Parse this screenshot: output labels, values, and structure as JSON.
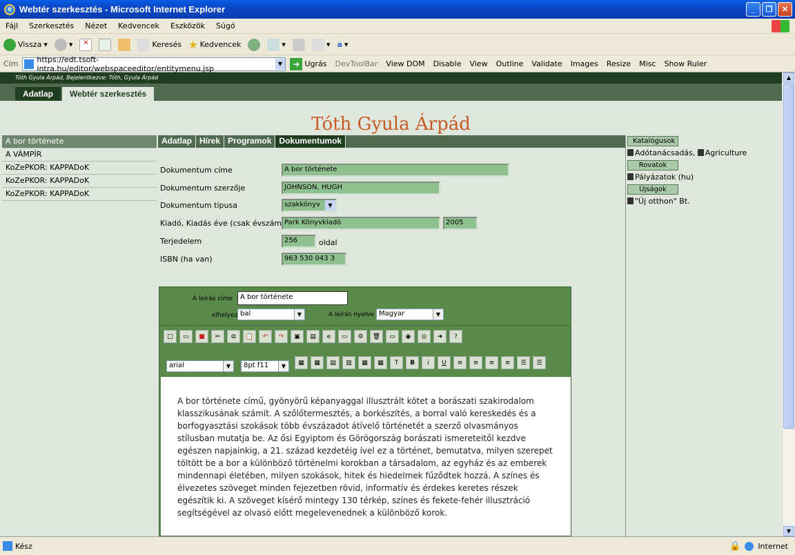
{
  "window": {
    "title": "Webtér szerkesztés - Microsoft Internet Explorer"
  },
  "menu": [
    "Fájl",
    "Szerkesztés",
    "Nézet",
    "Kedvencek",
    "Eszközök",
    "Súgó"
  ],
  "toolbar": {
    "back": "Vissza",
    "search": "Keresés",
    "favorites": "Kedvencek"
  },
  "address": {
    "label": "Cím",
    "url": "https://edt.tsoft-intra.hu/editor/webspaceeditor/entitymenu.jsp",
    "go": "Ugrás"
  },
  "devtools": [
    "DevToolBar",
    "View DOM",
    "Disable",
    "View",
    "Outline",
    "Validate",
    "Images",
    "Resize",
    "Misc",
    "Show Ruler"
  ],
  "header": {
    "login": "Tóth Gyula Árpád, Bejelentkezve: Tóth, Gyula Árpád",
    "tabs": [
      "Adatlap",
      "Webtér szerkesztés"
    ],
    "person": "Tóth Gyula Árpád"
  },
  "left_items": [
    "A bor története",
    "A VÁMPÍR",
    "KoZePKOR: KAPPADoK",
    "KoZePKOR: KAPPADoK",
    "KoZePKOR: KAPPADoK"
  ],
  "mid_tabs": [
    "Adatlap",
    "Hírek",
    "Programok",
    "Dokumentumok"
  ],
  "form": {
    "title_label": "Dokumentum címe",
    "title_value": "A bor története",
    "author_label": "Dokumentum szerzője",
    "author_value": "JOHNSON, HUGH",
    "type_label": "Dokumentum típusa",
    "type_value": "szakkönyv",
    "publisher_label": "Kiadó, Kiadás éve (csak évszám)",
    "publisher_value": "Park Könyvkiadó",
    "year_value": "2005",
    "pages_label": "Terjedelem",
    "pages_value": "256",
    "pages_unit": "oldal",
    "isbn_label": "ISBN (ha van)",
    "isbn_value": "963 530 043 3"
  },
  "editor": {
    "desc_title_label": "A leírás címe",
    "desc_title_value": "A bor története",
    "placement_label": "elhelyezés",
    "placement_value": "bal",
    "lang_label": "A leírás nyelve",
    "lang_value": "Magyar",
    "font_value": "arial",
    "size_value": "8pt f11",
    "text": "A bor története című, gyönyörű képanyaggal illusztrált kötet a borászati szakirodalom klasszikusának számít. A szőlőtermesztés, a borkészítés, a borral való kereskedés és a borfogyasztási szokások több évszázadot átívelő történetét a szerző olvasmányos stílusban mutatja be. Az ősi Egyiptom és Görögország borászati ismereteitől kezdve egészen napjainkig, a 21. század kezdetéig ível ez a történet, bemutatva, milyen szerepet töltött be a bor a különböző történelmi korokban a társadalom, az egyház és az emberek mindennapi életében, milyen szokások, hitek és hiedelmek fűződtek hozzá. A színes és élvezetes szöveget minden fejezetben rövid, informatív és érdekes keretes részek egészítik ki. A szöveget kísérő mintegy 130 térkép, színes és fekete-fehér illusztráció segítségével az olvasó előtt megelevenednek a különböző korok."
  },
  "right": {
    "catalog_btn": "Katalógusok",
    "catalog_items": "Adótanácsadás,",
    "catalog_items2": "Agriculture",
    "rovat_btn": "Rovatok",
    "rovat_item": "Pályázatok (hu)",
    "ujsag_btn": "Újságok",
    "ujsag_item": "\"Új otthon\" Bt."
  },
  "status": {
    "text": "Kész",
    "zone": "Internet"
  }
}
